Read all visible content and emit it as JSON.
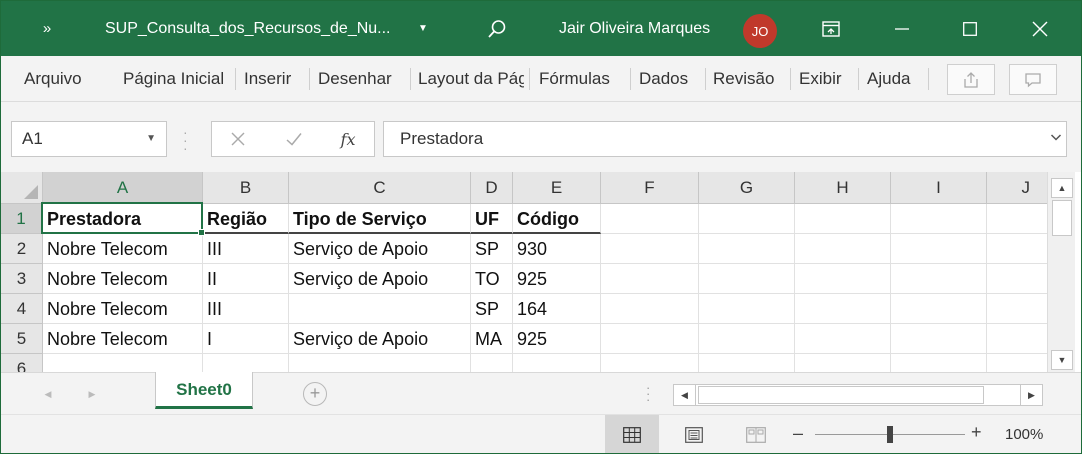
{
  "titlebar": {
    "qa_more": "»",
    "doc_title": "SUP_Consulta_dos_Recursos_de_Nu...",
    "user_name": "Jair Oliveira Marques",
    "user_initials": "JO"
  },
  "menu": {
    "items": [
      "Arquivo",
      "Página Inicial",
      "Inserir",
      "Desenhar",
      "Layout da Página",
      "Fórmulas",
      "Dados",
      "Revisão",
      "Exibir",
      "Ajuda"
    ]
  },
  "formula_bar": {
    "name_box": "A1",
    "formula": "Prestadora",
    "fx": "fx"
  },
  "sheet": {
    "columns": [
      "A",
      "B",
      "C",
      "D",
      "E",
      "F",
      "G",
      "H",
      "I",
      "J"
    ],
    "row_numbers": [
      "1",
      "2",
      "3",
      "4",
      "5",
      "6"
    ],
    "header_row": [
      "Prestadora",
      "Região",
      "Tipo de Serviço",
      "UF",
      "Código"
    ],
    "rows": [
      [
        "Nobre Telecom",
        "III",
        "Serviço de Apoio",
        "SP",
        "930"
      ],
      [
        "Nobre Telecom",
        "II",
        "Serviço de Apoio",
        "TO",
        "925"
      ],
      [
        "Nobre Telecom",
        "III",
        "",
        "SP",
        "164"
      ],
      [
        "Nobre Telecom",
        "I",
        "Serviço de Apoio",
        "MA",
        "925"
      ]
    ],
    "active_cell": "A1"
  },
  "tabs": {
    "sheets": [
      "Sheet0"
    ]
  },
  "status": {
    "zoom": "100%"
  },
  "colors": {
    "excel_green": "#217346",
    "avatar_red": "#c0392b"
  }
}
